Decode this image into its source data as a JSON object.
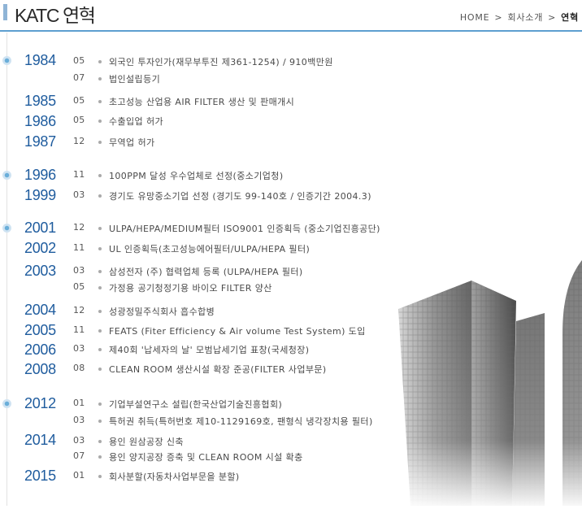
{
  "header": {
    "title": "KATC 연혁",
    "breadcrumb": [
      "HOME",
      "회사소개",
      "연혁"
    ],
    "accent_color": "#5d9fd0"
  },
  "timeline": [
    {
      "year": "1984",
      "dot": true,
      "events": [
        {
          "month": "05",
          "text": "외국인 투자인가(재무부투진 제361-1254) / 910백만원"
        },
        {
          "month": "07",
          "text": "법인설립등기"
        }
      ]
    },
    {
      "year": "1985",
      "dot": false,
      "events": [
        {
          "month": "05",
          "text": "초고성능 산업용 AIR FILTER 생산 및 판매개시"
        }
      ]
    },
    {
      "year": "1986",
      "dot": false,
      "events": [
        {
          "month": "05",
          "text": "수출입업 허가"
        }
      ]
    },
    {
      "year": "1987",
      "dot": false,
      "events": [
        {
          "month": "12",
          "text": "무역업 허가"
        }
      ]
    },
    {
      "year": "1996",
      "dot": true,
      "events": [
        {
          "month": "11",
          "text": "100PPM 달성 우수업체로 선정(중소기업청)"
        }
      ]
    },
    {
      "year": "1999",
      "dot": false,
      "events": [
        {
          "month": "03",
          "text": "경기도 유망중소기업 선정 (경기도 99-140호 / 인증기간 2004.3)"
        }
      ]
    },
    {
      "year": "2001",
      "dot": true,
      "events": [
        {
          "month": "12",
          "text": "ULPA/HEPA/MEDIUM필터 ISO9001 인증획득 (중소기업진흥공단)"
        }
      ]
    },
    {
      "year": "2002",
      "dot": false,
      "events": [
        {
          "month": "11",
          "text": "UL 인증획득(초고성능에어필터/ULPA/HEPA 필터)"
        }
      ]
    },
    {
      "year": "2003",
      "dot": false,
      "events": [
        {
          "month": "03",
          "text": "삼성전자 (주) 협력업체 등록 (ULPA/HEPA 필터)"
        },
        {
          "month": "05",
          "text": "가정용 공기청정기용 바이오 FILTER 양산"
        }
      ]
    },
    {
      "year": "2004",
      "dot": false,
      "events": [
        {
          "month": "12",
          "text": "성광정밀주식회사 흡수합병"
        }
      ]
    },
    {
      "year": "2005",
      "dot": false,
      "events": [
        {
          "month": "11",
          "text": "FEATS (Fiter Efficiency & Air volume Test System) 도입"
        }
      ]
    },
    {
      "year": "2006",
      "dot": false,
      "events": [
        {
          "month": "03",
          "text": "제40회 '납세자의 날' 모범납세기업 표창(국세청장)"
        }
      ]
    },
    {
      "year": "2008",
      "dot": false,
      "events": [
        {
          "month": "08",
          "text": "CLEAN ROOM 생산시설 확장 준공(FILTER 사업부문)"
        }
      ]
    },
    {
      "year": "2012",
      "dot": true,
      "events": [
        {
          "month": "01",
          "text": "기업부설연구소 설립(한국산업기술진흥협회)"
        },
        {
          "month": "03",
          "text": "특허권 취득(특허번호 제10-1129169호, 팬형식 냉각장치용 필터)"
        }
      ]
    },
    {
      "year": "2014",
      "dot": false,
      "events": [
        {
          "month": "03",
          "text": "용인 원삼공장 신축"
        },
        {
          "month": "07",
          "text": "용인 양지공장 증축 및 CLEAN ROOM 시설 확충"
        }
      ]
    },
    {
      "year": "2015",
      "dot": false,
      "events": [
        {
          "month": "01",
          "text": "회사분할(자동차사업부문을 분할)"
        }
      ]
    }
  ]
}
